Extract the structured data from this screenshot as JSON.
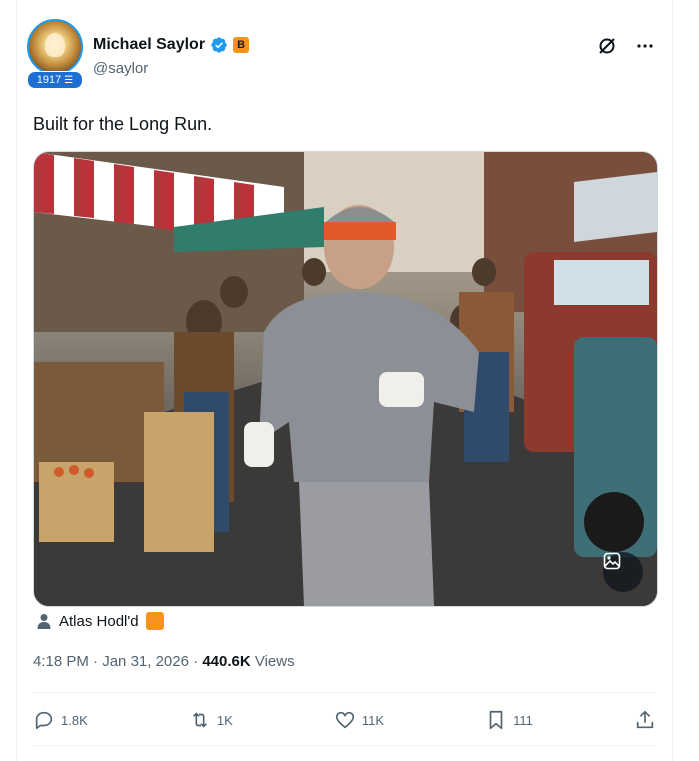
{
  "author": {
    "name": "Michael Saylor",
    "handle": "@saylor",
    "badge_count": "1917",
    "btc_badge": "B"
  },
  "tweet": {
    "text": "Built for the Long Run."
  },
  "media": {
    "description_icon": "image-edit-icon"
  },
  "credit": {
    "label": "Atlas Hodl'd"
  },
  "meta": {
    "time": "4:18 PM",
    "sep1": "·",
    "date": "Jan 31, 2026",
    "sep2": "·",
    "views_count": "440.6K",
    "views_label": "Views"
  },
  "actions": {
    "replies": "1.8K",
    "reposts": "1K",
    "likes": "11K",
    "bookmarks": "111"
  },
  "colors": {
    "accent": "#1d9bf0",
    "bitcoin": "#f7931a",
    "muted": "#536471"
  }
}
